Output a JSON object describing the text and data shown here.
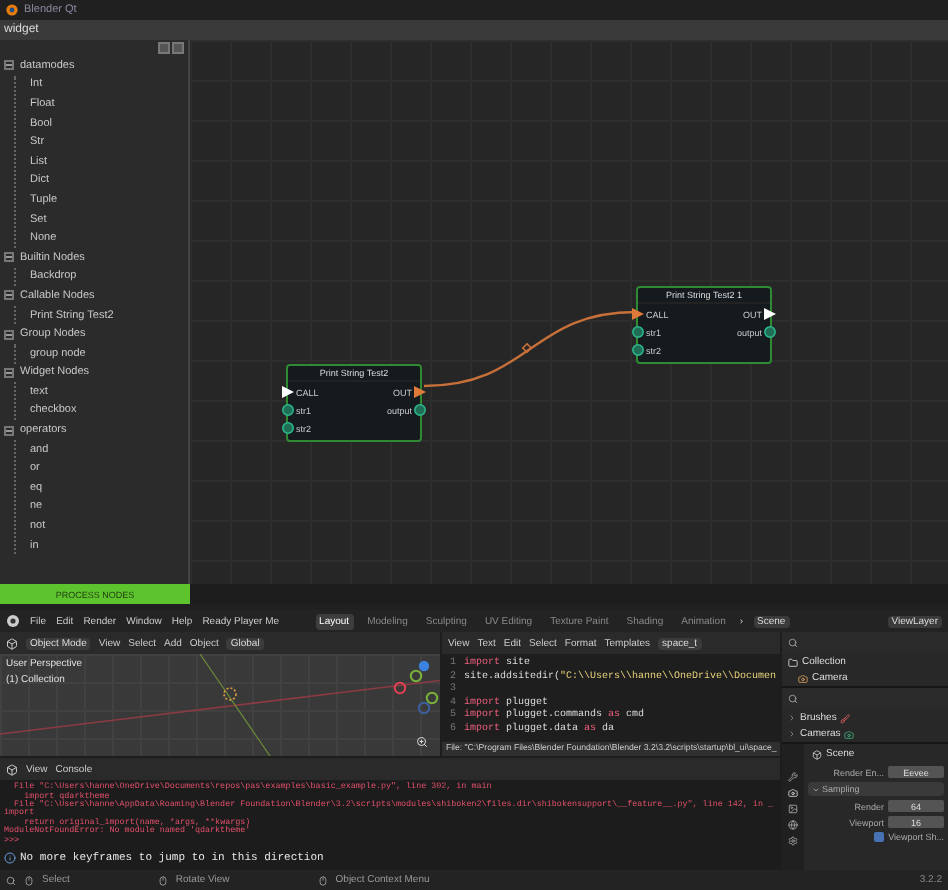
{
  "app_title": "Blender Qt",
  "widget_title": "widget",
  "tree": [
    {
      "label": "datamodes",
      "expanded": true,
      "children": [
        {
          "label": "Int"
        },
        {
          "label": "Float"
        },
        {
          "label": "Bool"
        },
        {
          "label": "Str"
        },
        {
          "label": "List"
        },
        {
          "label": "Dict"
        },
        {
          "label": "Tuple"
        },
        {
          "label": "Set"
        },
        {
          "label": "None"
        }
      ]
    },
    {
      "label": "Builtin Nodes",
      "expanded": true,
      "children": [
        {
          "label": "Backdrop"
        }
      ]
    },
    {
      "label": "Callable Nodes",
      "expanded": true,
      "children": [
        {
          "label": "Print String Test2"
        }
      ]
    },
    {
      "label": "Group Nodes",
      "expanded": true,
      "children": [
        {
          "label": "group node"
        }
      ]
    },
    {
      "label": "Widget Nodes",
      "expanded": true,
      "children": [
        {
          "label": "text"
        },
        {
          "label": "checkbox"
        }
      ]
    },
    {
      "label": "operators",
      "expanded": true,
      "children": [
        {
          "label": "and"
        },
        {
          "label": "or"
        },
        {
          "label": "eq"
        },
        {
          "label": "ne"
        },
        {
          "label": "not"
        },
        {
          "label": "in"
        }
      ]
    }
  ],
  "nodes": [
    {
      "title": "Print String Test2",
      "inputs": [
        {
          "label": "CALL",
          "kind": "exec",
          "connected": false
        },
        {
          "label": "str1",
          "kind": "data",
          "connected": false
        },
        {
          "label": "str2",
          "kind": "data",
          "connected": false
        }
      ],
      "outputs": [
        {
          "label": "OUT",
          "kind": "exec",
          "connected": true
        },
        {
          "label": "output",
          "kind": "data",
          "connected": false
        }
      ]
    },
    {
      "title": "Print String Test2 1",
      "inputs": [
        {
          "label": "CALL",
          "kind": "exec",
          "connected": true
        },
        {
          "label": "str1",
          "kind": "data",
          "connected": false
        },
        {
          "label": "str2",
          "kind": "data",
          "connected": false
        }
      ],
      "outputs": [
        {
          "label": "OUT",
          "kind": "exec",
          "connected": false
        },
        {
          "label": "output",
          "kind": "data",
          "connected": false
        }
      ]
    }
  ],
  "process_button": "PROCESS NODES",
  "topbar": {
    "menus": [
      "File",
      "Edit",
      "Render",
      "Window",
      "Help",
      "Ready Player Me"
    ],
    "workspaces": [
      {
        "label": "Layout",
        "selected": true
      },
      {
        "label": "Modeling",
        "selected": false
      },
      {
        "label": "Sculpting",
        "selected": false
      },
      {
        "label": "UV Editing",
        "selected": false
      },
      {
        "label": "Texture Paint",
        "selected": false
      },
      {
        "label": "Shading",
        "selected": false
      },
      {
        "label": "Animation",
        "selected": false
      }
    ],
    "more": "›",
    "scene": "Scene",
    "view_layer": "ViewLayer"
  },
  "viewport": {
    "mode": "Object Mode",
    "menus": [
      "View",
      "Select",
      "Add",
      "Object"
    ],
    "orientation": "Global",
    "overlay": [
      "User Perspective",
      "(1) Collection"
    ]
  },
  "text_editor": {
    "menus": [
      "View",
      "Text",
      "Edit",
      "Select",
      "Format",
      "Templates"
    ],
    "file_name": "space_t",
    "lines": [
      {
        "number": "1",
        "tokens": [
          {
            "text": "import",
            "kind": "keyword"
          },
          {
            "text": " site",
            "kind": "plain"
          }
        ]
      },
      {
        "number": "2",
        "tokens": [
          {
            "text": "site.addsitedir(",
            "kind": "plain"
          },
          {
            "text": "\"C:\\\\Users\\\\hanne\\\\OneDrive\\\\Documen",
            "kind": "string"
          }
        ]
      },
      {
        "number": "3"
      },
      {
        "number": "4",
        "tokens": [
          {
            "text": "import",
            "kind": "keyword"
          },
          {
            "text": " plugget",
            "kind": "plain"
          }
        ]
      },
      {
        "number": "5",
        "tokens": [
          {
            "text": "import",
            "kind": "keyword"
          },
          {
            "text": " plugget.commands ",
            "kind": "plain"
          },
          {
            "text": "as",
            "kind": "keyword"
          },
          {
            "text": " cmd",
            "kind": "plain"
          }
        ]
      },
      {
        "number": "6",
        "tokens": [
          {
            "text": "import",
            "kind": "keyword"
          },
          {
            "text": " plugget.data ",
            "kind": "plain"
          },
          {
            "text": "as",
            "kind": "keyword"
          },
          {
            "text": " da",
            "kind": "plain"
          }
        ]
      }
    ],
    "footer": "File: \"C:\\Program Files\\Blender Foundation\\Blender 3.2\\3.2\\scripts\\startup\\bl_ui\\space_"
  },
  "console": {
    "menus": [
      "View",
      "Console"
    ],
    "output": [
      "  File \"C:\\Users\\hanne\\OneDrive\\Documents\\repos\\pas\\examples\\basic_example.py\", line 302, in main",
      "    import qdarktheme",
      "  File \"C:\\Users\\hanne\\AppData\\Roaming\\Blender Foundation\\Blender\\3.2\\scripts\\modules\\shiboken2\\files.dir\\shibokensupport\\__feature__.py\", line 142, in _import",
      "    return original_import(name, *args, **kwargs)",
      "ModuleNotFoundError: No module named 'qdarktheme'"
    ],
    "prompt": ">>>",
    "info": "No more keyframes to jump to in this direction"
  },
  "outliner": {
    "items": [
      {
        "label": "Collection",
        "kind": "collection"
      },
      {
        "label": "Camera",
        "kind": "camera"
      }
    ]
  },
  "data_browser": {
    "items": [
      {
        "label": "Brushes",
        "kind": "brush"
      },
      {
        "label": "Cameras",
        "kind": "camera"
      }
    ]
  },
  "properties": {
    "scene": "Scene",
    "render_engine_label": "Render En...",
    "render_engine": "Eevee",
    "panel": "Sampling",
    "panel_expanded": true,
    "fields": [
      {
        "label": "Render",
        "value": "64"
      },
      {
        "label": "Viewport",
        "value": "16"
      }
    ],
    "checkbox": {
      "label": "Viewport Sh...",
      "checked": true
    }
  },
  "status_bar": {
    "hints": [
      "Select",
      "Rotate View",
      "Object Context Menu"
    ],
    "version": "3.2.2"
  }
}
